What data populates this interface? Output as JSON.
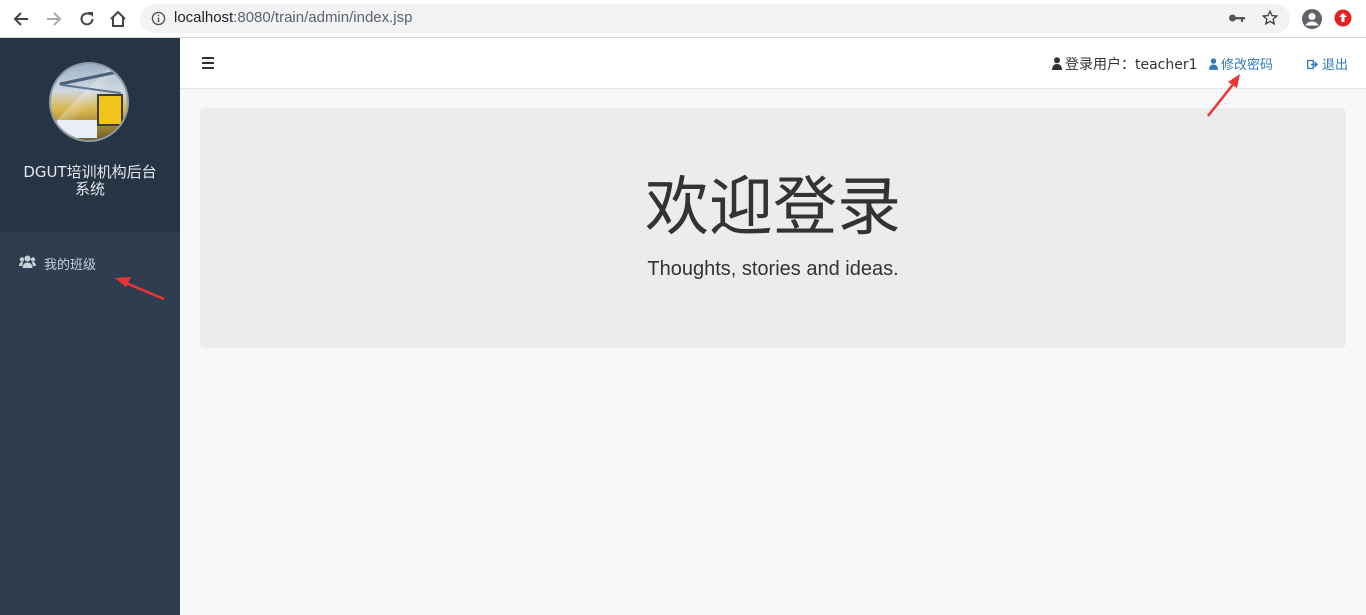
{
  "browser": {
    "url_host": "localhost",
    "url_rest": ":8080/train/admin/index.jsp"
  },
  "sidebar": {
    "title": "DGUT培训机构后台系统",
    "items": [
      {
        "label": "我的班级",
        "icon": "users-icon"
      }
    ]
  },
  "topbar": {
    "user_label": "登录用户：teacher1",
    "change_password": "修改密码",
    "logout": "退出"
  },
  "jumbotron": {
    "title": "欢迎登录",
    "subtitle": "Thoughts, stories and ideas."
  },
  "colors": {
    "sidebar_bg": "#2f3e4e",
    "sidebar_header_bg": "#263443",
    "link": "#337ab7",
    "annotation_arrow": "#ee3333"
  }
}
